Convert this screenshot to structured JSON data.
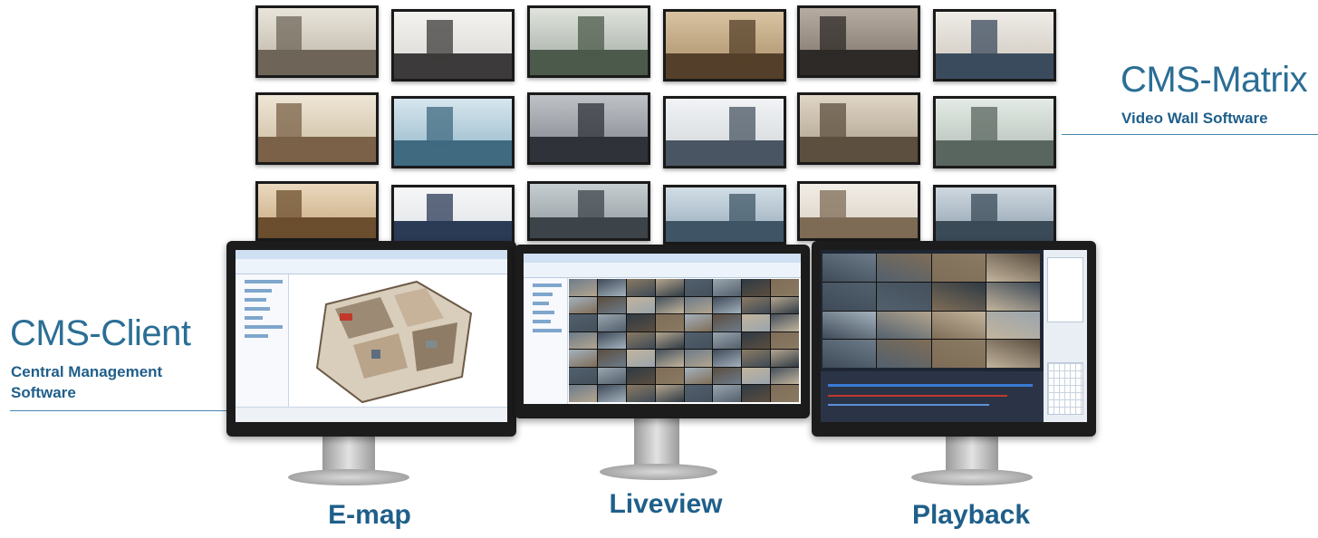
{
  "matrix": {
    "title": "CMS-Matrix",
    "subtitle": "Video Wall Software"
  },
  "client": {
    "title": "CMS-Client",
    "subtitle_line1": "Central Management",
    "subtitle_line2": "Software"
  },
  "monitors": [
    {
      "caption": "E-map"
    },
    {
      "caption": "Liveview"
    },
    {
      "caption": "Playback"
    }
  ],
  "colors": {
    "brand_blue": "#1f5f8a",
    "title_blue": "#2b6e95",
    "bezel": "#1c1c1c"
  }
}
